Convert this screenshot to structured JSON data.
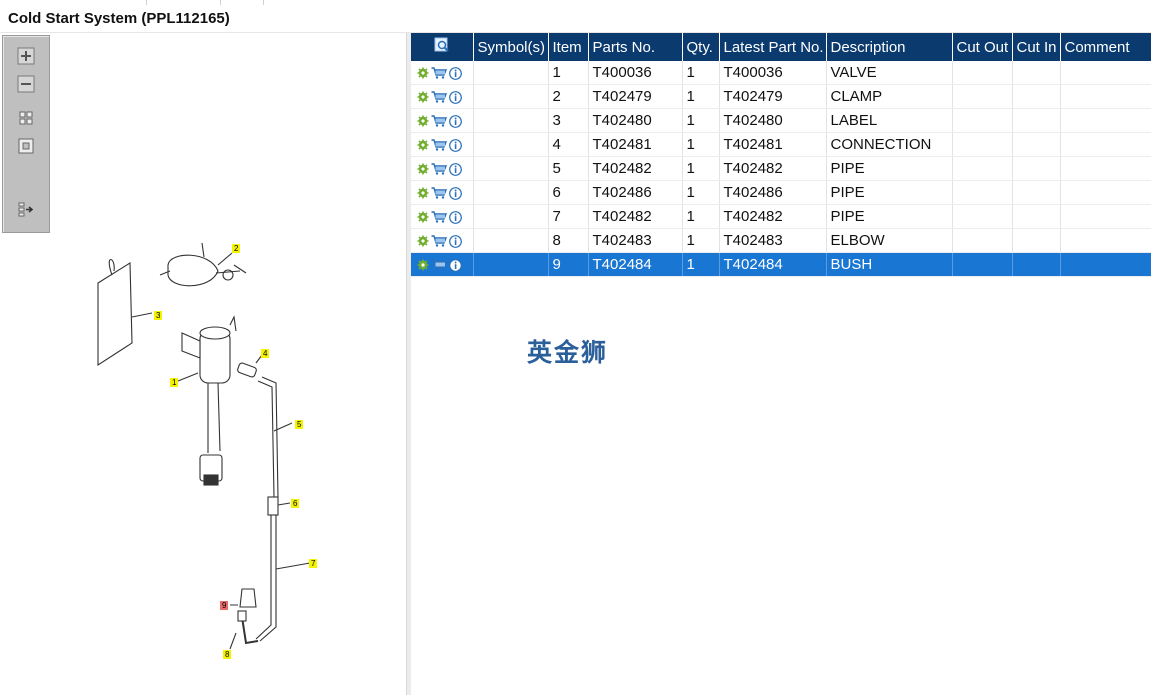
{
  "title": "Cold Start System (PPL112165)",
  "watermark": "英金狮",
  "colors": {
    "header_bg": "#0a3a6e",
    "selected_row": "#1976d2",
    "callout_yellow": "#f4f400",
    "callout_red": "#e86a6a"
  },
  "toolbar": {
    "buttons": [
      {
        "name": "zoom-in-icon"
      },
      {
        "name": "zoom-out-icon"
      },
      {
        "name": "fit-all-icon"
      },
      {
        "name": "actual-size-icon"
      },
      {
        "name": "export-icon"
      }
    ]
  },
  "diagram": {
    "callouts": [
      "1",
      "2",
      "3",
      "4",
      "5",
      "6",
      "7",
      "8",
      "9"
    ],
    "highlighted_callout": "9"
  },
  "table": {
    "columns": [
      "",
      "Symbol(s)",
      "Item",
      "Parts No.",
      "Qty.",
      "Latest Part No.",
      "Description",
      "Cut Out",
      "Cut In",
      "Comment"
    ],
    "row_icons": [
      "gear-icon",
      "cart-icon",
      "info-icon"
    ],
    "rows": [
      {
        "item": "1",
        "part_no": "T400036",
        "qty": "1",
        "latest": "T400036",
        "desc": "VALVE"
      },
      {
        "item": "2",
        "part_no": "T402479",
        "qty": "1",
        "latest": "T402479",
        "desc": "CLAMP"
      },
      {
        "item": "3",
        "part_no": "T402480",
        "qty": "1",
        "latest": "T402480",
        "desc": "LABEL"
      },
      {
        "item": "4",
        "part_no": "T402481",
        "qty": "1",
        "latest": "T402481",
        "desc": "CONNECTION"
      },
      {
        "item": "5",
        "part_no": "T402482",
        "qty": "1",
        "latest": "T402482",
        "desc": "PIPE"
      },
      {
        "item": "6",
        "part_no": "T402486",
        "qty": "1",
        "latest": "T402486",
        "desc": "PIPE"
      },
      {
        "item": "7",
        "part_no": "T402482",
        "qty": "1",
        "latest": "T402482",
        "desc": "PIPE"
      },
      {
        "item": "8",
        "part_no": "T402483",
        "qty": "1",
        "latest": "T402483",
        "desc": "ELBOW"
      },
      {
        "item": "9",
        "part_no": "T402484",
        "qty": "1",
        "latest": "T402484",
        "desc": "BUSH",
        "selected": true
      }
    ]
  }
}
